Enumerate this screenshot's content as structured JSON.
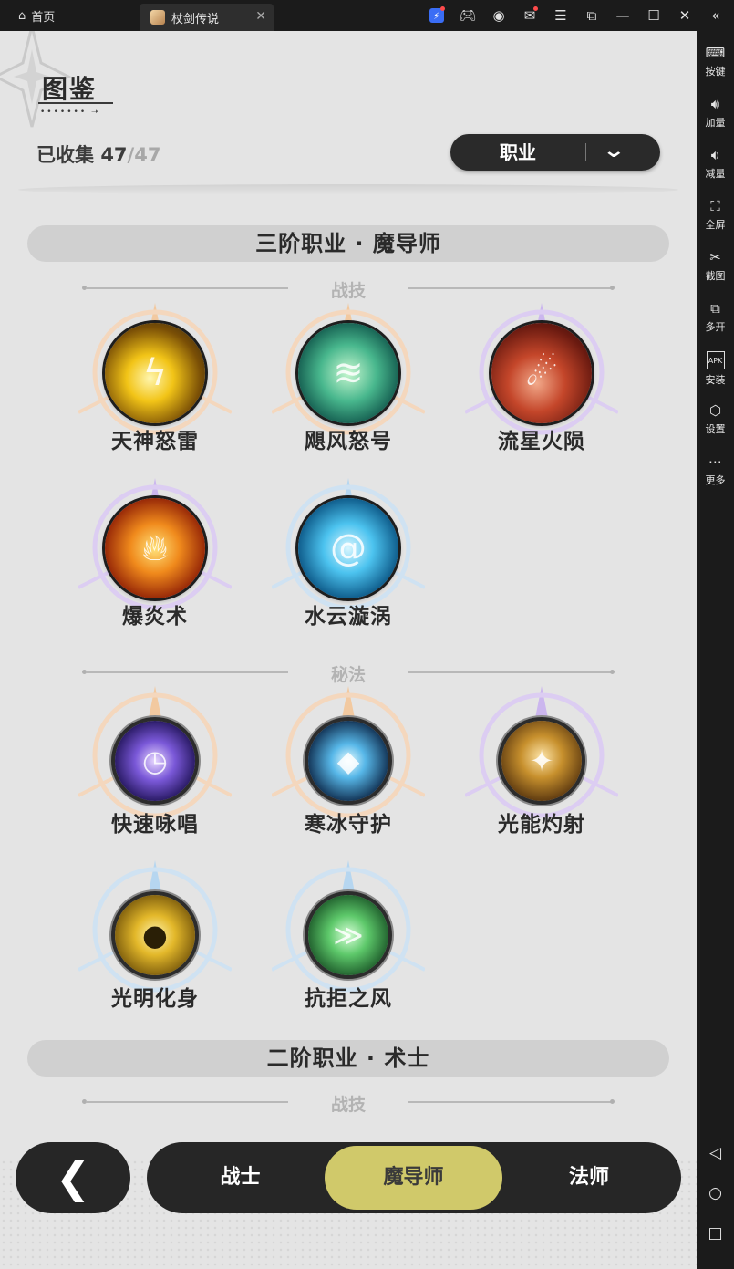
{
  "window": {
    "home_tab": "首页",
    "game_tab": "杖剑传说"
  },
  "top_icons": [
    "bolt-icon",
    "gamepad-icon",
    "account-icon",
    "mail-icon",
    "menu-icon",
    "restore-small-icon",
    "minimize-icon",
    "maximize-icon",
    "close-icon",
    "collapse-sidebar-icon"
  ],
  "sidebar": {
    "items": [
      {
        "label": "按键",
        "icon": "keyboard-icon"
      },
      {
        "label": "加量",
        "icon": "volume-up-icon"
      },
      {
        "label": "减量",
        "icon": "volume-down-icon"
      },
      {
        "label": "全屏",
        "icon": "fullscreen-icon"
      },
      {
        "label": "截图",
        "icon": "scissors-icon"
      },
      {
        "label": "多开",
        "icon": "multi-instance-icon"
      },
      {
        "label": "安装",
        "icon": "apk-icon"
      },
      {
        "label": "设置",
        "icon": "settings-icon"
      },
      {
        "label": "更多",
        "icon": "more-icon"
      }
    ]
  },
  "page": {
    "title": "图鉴",
    "collected_label": "已收集",
    "collected": "47",
    "total": "/47",
    "filter_label": "职业"
  },
  "sections": [
    {
      "title": "三阶职业 · 魔导师",
      "groups": [
        {
          "heading": "战技",
          "skills": [
            "天神怒雷",
            "飓风怒号",
            "流星火陨",
            "爆炎术",
            "水云漩涡"
          ]
        },
        {
          "heading": "秘法",
          "skills": [
            "快速咏唱",
            "寒冰守护",
            "光能灼射",
            "光明化身",
            "抗拒之风"
          ]
        }
      ]
    },
    {
      "title": "二阶职业 · 术士",
      "groups": [
        {
          "heading": "战技",
          "skills": []
        }
      ]
    }
  ],
  "bottom_nav": {
    "tabs": [
      "战士",
      "魔导师",
      "法师"
    ],
    "active": "魔导师"
  },
  "colors": {
    "accent_tab": "#d0c96a",
    "dark_pill": "#262626",
    "page_bg": "#e4e4e4",
    "section_bar": "#d0d0d0"
  }
}
